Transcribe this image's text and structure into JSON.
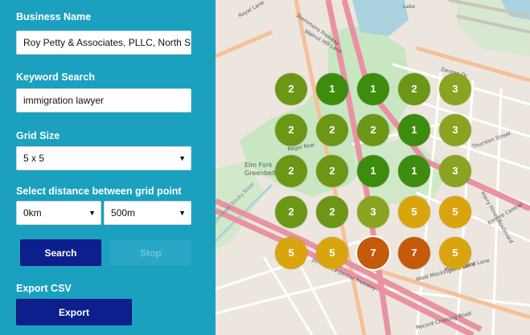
{
  "form": {
    "business_label": "Business Name",
    "business_value": "Roy Petty & Associates, PLLC, North St",
    "keyword_label": "Keyword Search",
    "keyword_value": "immigration lawyer",
    "grid_label": "Grid Size",
    "grid_value": "5 x 5",
    "distance_label": "Select distance between grid point",
    "distance_from": "0km",
    "distance_to": "500m",
    "search_label": "Search",
    "stop_label": "Stop",
    "export_section": "Export CSV",
    "export_label": "Export"
  },
  "map": {
    "street_labels": [
      "Denton Dr",
      "Lake",
      "Walnut Hill Lane",
      "Regal Row",
      "Elm Fork",
      "Greenbelt",
      "Elm Fork Trinity River",
      "John W Carpenter Freeway",
      "Stemmons Freeway",
      "Harry Hines Boulevard",
      "Thurston Street",
      "Empire Central",
      "West Mockingbird Lane",
      "Record Crossing Road",
      "Mockingbird Lane",
      "Royal Lane"
    ],
    "ranks": [
      [
        2,
        1,
        1,
        2,
        3
      ],
      [
        2,
        2,
        2,
        1,
        3
      ],
      [
        2,
        2,
        1,
        1,
        3
      ],
      [
        2,
        2,
        3,
        5,
        5
      ],
      [
        5,
        5,
        7,
        7,
        5
      ]
    ],
    "rank_colors": {
      "1": "#3d8c0d",
      "2": "#6c9716",
      "3": "#8aa321",
      "5": "#d9a40e",
      "7": "#c45a0a"
    },
    "selected_cell": [
      4,
      2
    ]
  }
}
